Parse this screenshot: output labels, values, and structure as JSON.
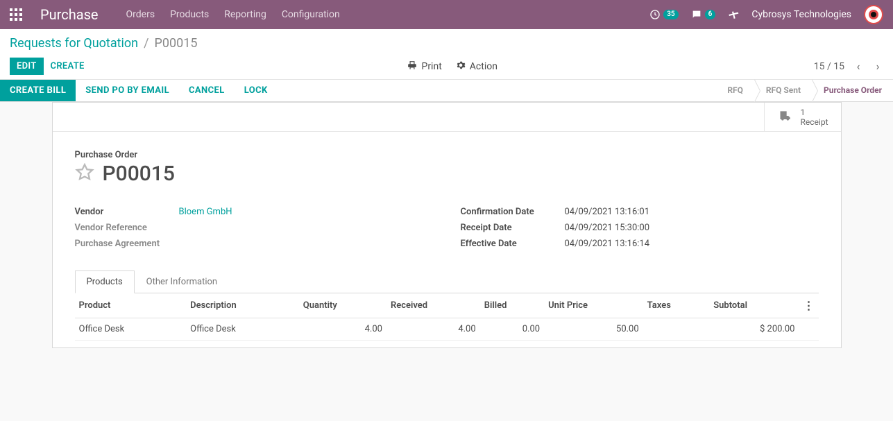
{
  "topnav": {
    "brand": "Purchase",
    "links": [
      "Orders",
      "Products",
      "Reporting",
      "Configuration"
    ],
    "activity_count": "35",
    "message_count": "6",
    "company": "Cybrosys Technologies"
  },
  "breadcrumb": {
    "parent": "Requests for Quotation",
    "current": "P00015"
  },
  "cp_buttons": {
    "edit": "Edit",
    "create": "Create",
    "print": "Print",
    "action": "Action"
  },
  "pager": {
    "text": "15 / 15"
  },
  "statusbar_buttons": {
    "create_bill": "Create Bill",
    "send_po": "Send PO by Email",
    "cancel": "Cancel",
    "lock": "Lock"
  },
  "stages": {
    "rfq": "RFQ",
    "rfq_sent": "RFQ Sent",
    "po": "Purchase Order"
  },
  "stat_button": {
    "count": "1",
    "label": "Receipt"
  },
  "form": {
    "title_label": "Purchase Order",
    "po_name": "P00015",
    "left": {
      "vendor_label": "Vendor",
      "vendor_value": "Bloem GmbH",
      "vendor_ref_label": "Vendor Reference",
      "vendor_ref_value": "",
      "agreement_label": "Purchase Agreement",
      "agreement_value": ""
    },
    "right": {
      "confirm_label": "Confirmation Date",
      "confirm_value": "04/09/2021 13:16:01",
      "receipt_label": "Receipt Date",
      "receipt_value": "04/09/2021 15:30:00",
      "effective_label": "Effective Date",
      "effective_value": "04/09/2021 13:16:14"
    }
  },
  "tabs": {
    "products": "Products",
    "other": "Other Information"
  },
  "table": {
    "headers": {
      "product": "Product",
      "description": "Description",
      "quantity": "Quantity",
      "received": "Received",
      "billed": "Billed",
      "unit_price": "Unit Price",
      "taxes": "Taxes",
      "subtotal": "Subtotal"
    },
    "row0": {
      "product": "Office Desk",
      "description": "Office Desk",
      "quantity": "4.00",
      "received": "4.00",
      "billed": "0.00",
      "unit_price": "50.00",
      "taxes": "",
      "subtotal": "$ 200.00"
    }
  }
}
